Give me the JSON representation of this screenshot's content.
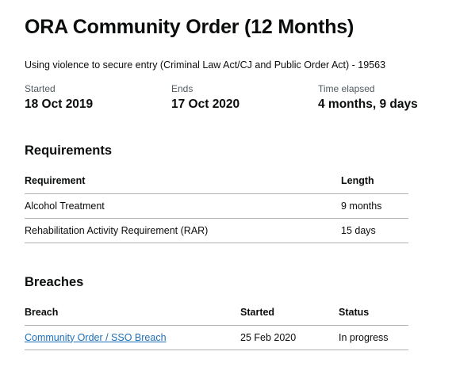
{
  "order": {
    "title": "ORA Community Order (12 Months)",
    "offence": "Using violence to secure entry (Criminal Law Act/CJ and Public Order Act) - 19563"
  },
  "dates": {
    "started_label": "Started",
    "started_value": "18 Oct 2019",
    "ends_label": "Ends",
    "ends_value": "17 Oct 2020",
    "elapsed_label": "Time elapsed",
    "elapsed_value": "4 months, 9 days"
  },
  "requirements": {
    "heading": "Requirements",
    "columns": [
      "Requirement",
      "Length"
    ],
    "rows": [
      [
        "Alcohol Treatment",
        "9 months"
      ],
      [
        "Rehabilitation Activity Requirement (RAR)",
        "15 days"
      ]
    ]
  },
  "breaches": {
    "heading": "Breaches",
    "columns": [
      "Breach",
      "Started",
      "Status"
    ],
    "rows": [
      [
        "Community Order / SSO Breach",
        "25 Feb 2020",
        "In progress"
      ]
    ]
  },
  "colors": {
    "text": "#0b0c0c",
    "secondary_text": "#505a5f",
    "link": "#1d70b8",
    "border": "#b1b4b6"
  }
}
